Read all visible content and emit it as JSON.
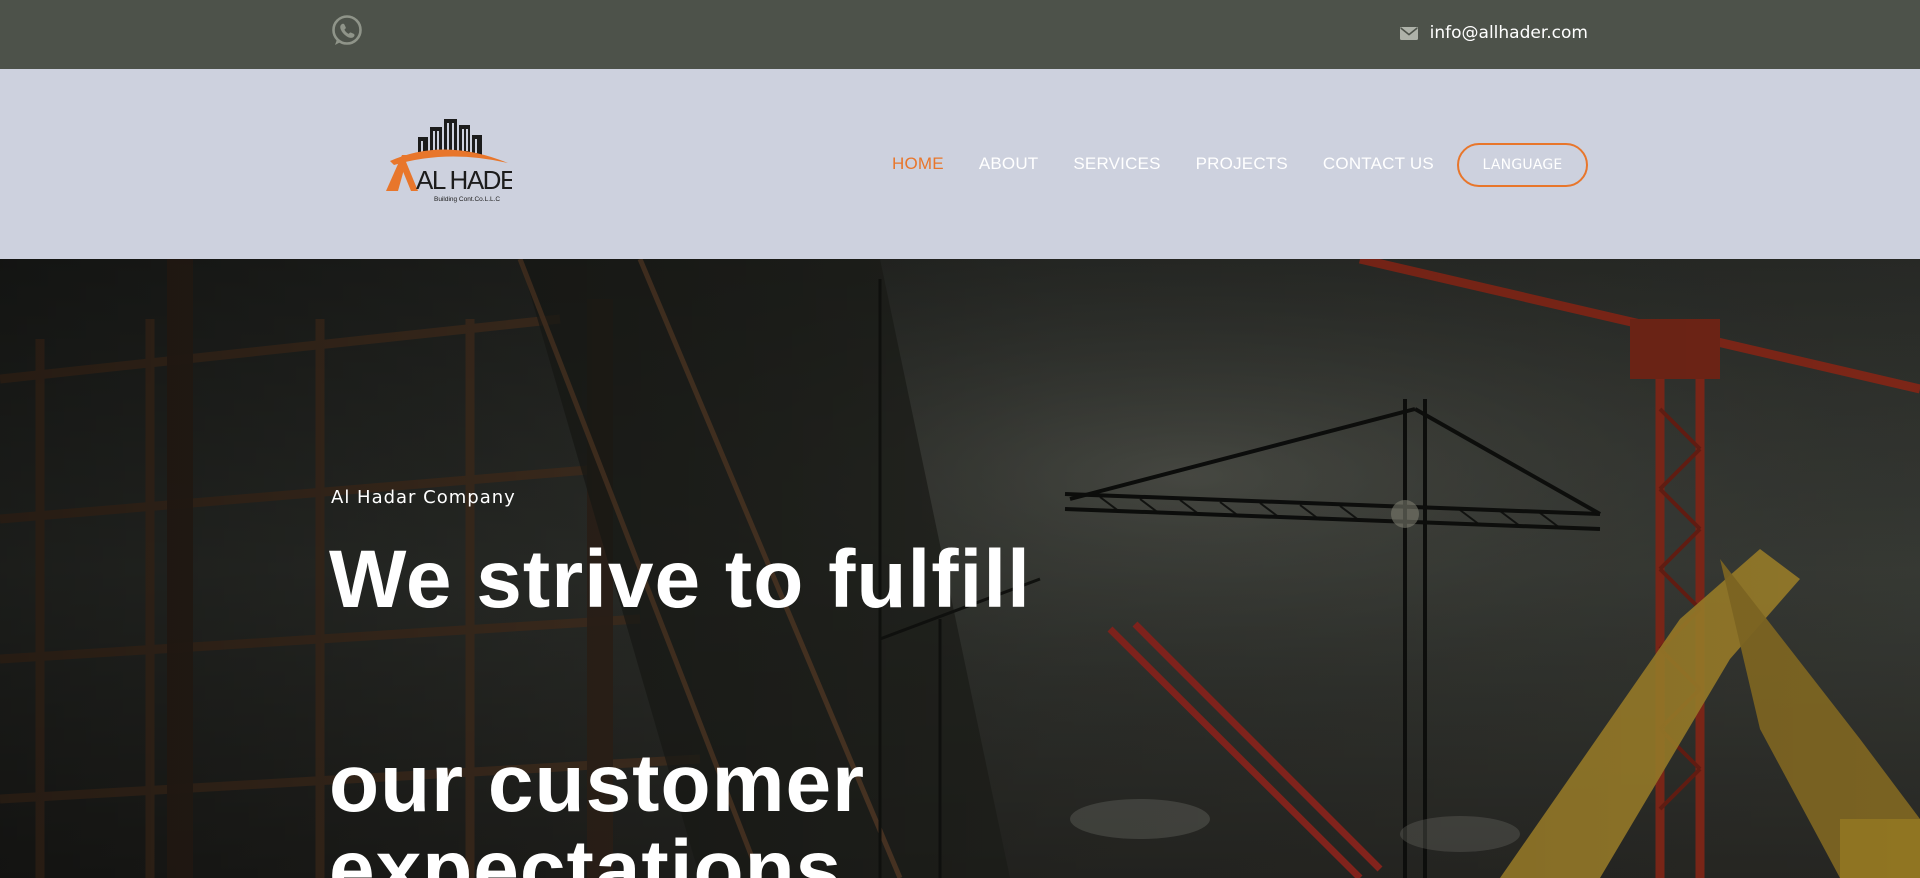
{
  "topbar": {
    "whatsapp_icon": "whatsapp-icon",
    "mail_icon": "envelope-icon",
    "email": "info@allhader.com"
  },
  "header": {
    "logo": {
      "brand": "AL HADER",
      "tagline": "Building Cont.Co.L.L.C"
    },
    "nav": [
      {
        "label": "HOME",
        "active": true
      },
      {
        "label": "ABOUT",
        "active": false
      },
      {
        "label": "SERVICES",
        "active": false
      },
      {
        "label": "PROJECTS",
        "active": false
      },
      {
        "label": "CONTACT US",
        "active": false
      }
    ],
    "language_label": "LANGUAGE"
  },
  "hero": {
    "subtitle": "Al Hadar Company",
    "title_lines": [
      "We strive to fulfill",
      "our customer",
      "expectations"
    ]
  },
  "colors": {
    "topbar_bg": "#4d524a",
    "header_bg": "#cdd1de",
    "accent": "#e8762b"
  }
}
